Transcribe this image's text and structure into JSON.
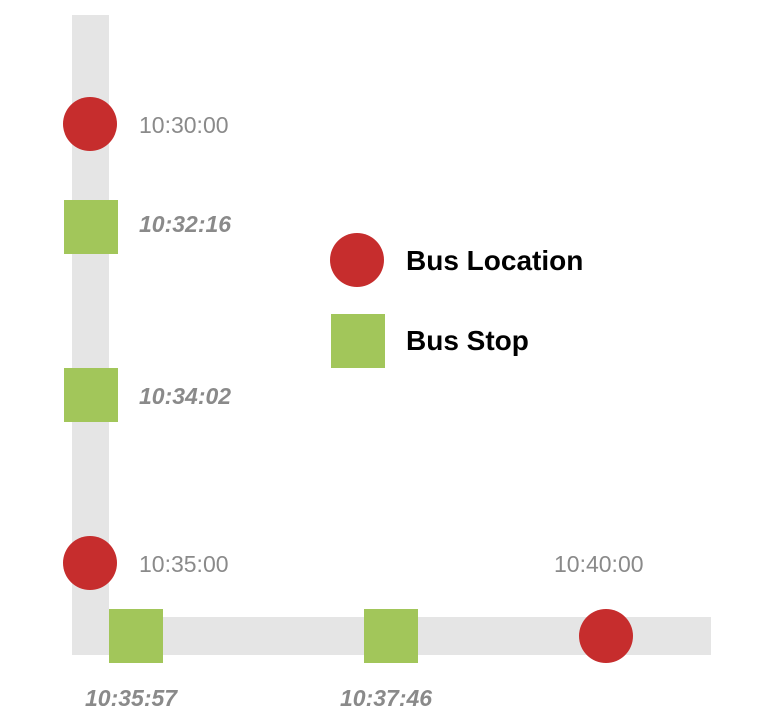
{
  "colors": {
    "road": "#e5e5e5",
    "bus_location": "#c62d2d",
    "bus_stop": "#a2c65a",
    "time_text": "#8a8a8a",
    "legend_text": "#000000"
  },
  "legend": {
    "bus_location_label": "Bus Location",
    "bus_stop_label": "Bus Stop"
  },
  "bus_locations": [
    {
      "time": "10:30:00"
    },
    {
      "time": "10:35:00"
    },
    {
      "time": "10:40:00"
    }
  ],
  "bus_stops": [
    {
      "time": "10:32:16"
    },
    {
      "time": "10:34:02"
    },
    {
      "time": "10:35:57"
    },
    {
      "time": "10:37:46"
    }
  ]
}
